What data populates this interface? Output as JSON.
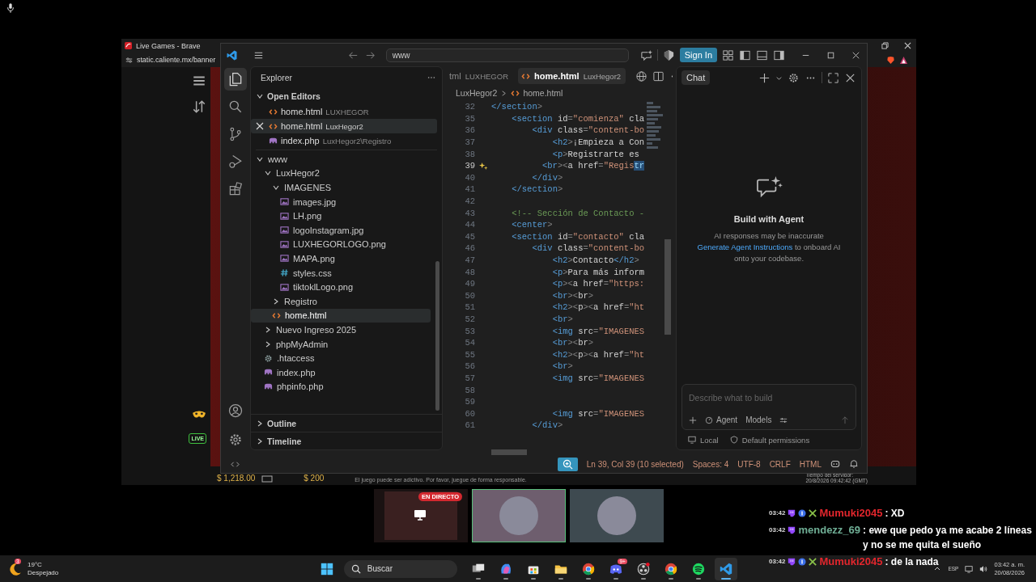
{
  "browser": {
    "tab_title": "Live Games - Brave",
    "address": "static.caliente.mx/banner",
    "live_badge": "LIVE",
    "balance": "$ 1,218.00",
    "bet": "$ 200",
    "disclaimer": "El juego puede ser adictivo. Por favor, juegue de forma responsable.",
    "server_time_label": "Tiempo del servidor:",
    "server_time": "20/8/2026 09:42:42 (GMT)"
  },
  "vscode": {
    "search": "www",
    "sign_in": "Sign In",
    "activity_bar": [
      {
        "kind": "files",
        "selected": true
      },
      {
        "kind": "search",
        "selected": false
      },
      {
        "kind": "source-control",
        "selected": false
      },
      {
        "kind": "run",
        "selected": false
      },
      {
        "kind": "extensions",
        "selected": false
      }
    ],
    "activity_bar_bottom": [
      {
        "kind": "account"
      },
      {
        "kind": "settings"
      }
    ],
    "explorer": {
      "title": "Explorer",
      "open_editors_title": "Open Editors",
      "open_editors": [
        {
          "name": "home.html",
          "description": "LUXHEGOR",
          "kind": "html",
          "selected": false
        },
        {
          "name": "home.html",
          "description": "LuxHegor2",
          "kind": "html",
          "selected": true
        },
        {
          "name": "index.php",
          "description": "LuxHegor2\\Registro",
          "kind": "php",
          "selected": false
        }
      ],
      "tree": [
        {
          "name": "www",
          "kind": "folder",
          "expanded": true,
          "selected": false,
          "children": [
            {
              "name": "LuxHegor2",
              "kind": "folder",
              "expanded": true,
              "selected": false,
              "children": [
                {
                  "name": "IMAGENES",
                  "kind": "folder",
                  "expanded": true,
                  "selected": false,
                  "children": [
                    {
                      "name": "images.jpg",
                      "kind": "image",
                      "selected": false
                    },
                    {
                      "name": "LH.png",
                      "kind": "image",
                      "selected": false
                    },
                    {
                      "name": "logoInstagram.jpg",
                      "kind": "image",
                      "selected": false
                    },
                    {
                      "name": "LUXHEGORLOGO.png",
                      "kind": "image",
                      "selected": false
                    },
                    {
                      "name": "MAPA.png",
                      "kind": "image",
                      "selected": false
                    },
                    {
                      "name": "styles.css",
                      "kind": "css",
                      "selected": false
                    },
                    {
                      "name": "tiktoklLogo.png",
                      "kind": "image",
                      "selected": false
                    }
                  ]
                },
                {
                  "name": "Registro",
                  "kind": "folder",
                  "expanded": false,
                  "selected": false
                },
                {
                  "name": "home.html",
                  "kind": "html",
                  "selected": true
                }
              ]
            },
            {
              "name": "Nuevo Ingreso 2025",
              "kind": "folder",
              "expanded": false,
              "selected": false
            },
            {
              "name": "phpMyAdmin",
              "kind": "folder",
              "expanded": false,
              "selected": false
            },
            {
              "name": ".htaccess",
              "kind": "config",
              "selected": false
            },
            {
              "name": "index.php",
              "kind": "php",
              "selected": false
            },
            {
              "name": "phpinfo.php",
              "kind": "php",
              "selected": false
            }
          ]
        }
      ],
      "sections": [
        {
          "title": "Outline",
          "expanded": false
        },
        {
          "title": "Timeline",
          "expanded": false
        }
      ]
    },
    "editor": {
      "tabs": [
        {
          "label": "tml",
          "description": "LUXHEGOR",
          "selected": false
        },
        {
          "label": "home.html",
          "description": "LuxHegor2",
          "selected": true
        }
      ],
      "breadcrumb": [
        "LuxHegor2",
        "home.html"
      ],
      "lines": [
        {
          "number": "32",
          "text": "</section>"
        },
        {
          "number": "35",
          "text": "    <section id=\"comienza\" cla"
        },
        {
          "number": "36",
          "text": "        <div class=\"content-bo"
        },
        {
          "number": "37",
          "text": "            <h2>¡Empieza a Con"
        },
        {
          "number": "38",
          "text": "            <p>Registrarte es"
        },
        {
          "number": "39",
          "text": "          <br><a href=\"Regis",
          "selected_text": "tr",
          "sparkle": true
        },
        {
          "number": "40",
          "text": "        </div>"
        },
        {
          "number": "41",
          "text": "    </section>"
        },
        {
          "number": "42"
        },
        {
          "number": "43",
          "text": "    <!-- Sección de Contacto -"
        },
        {
          "number": "44",
          "text": "    <center>"
        },
        {
          "number": "45",
          "text": "    <section id=\"contacto\" cla"
        },
        {
          "number": "46",
          "text": "        <div class=\"content-bo"
        },
        {
          "number": "47",
          "text": "            <h2>Contacto</h2>"
        },
        {
          "number": "48",
          "text": "            <p>Para más inform"
        },
        {
          "number": "49",
          "text": "            <p><a href=\"https:"
        },
        {
          "number": "50",
          "text": "            <br><br>"
        },
        {
          "number": "51",
          "text": "            <h2><p><a href=\"ht"
        },
        {
          "number": "52",
          "text": "            <br>"
        },
        {
          "number": "53",
          "text": "            <img src=\"IMAGENES"
        },
        {
          "number": "54",
          "text": "            <br><br>"
        },
        {
          "number": "55",
          "text": "            <h2><p><a href=\"ht"
        },
        {
          "number": "56",
          "text": "            <br>"
        },
        {
          "number": "57",
          "text": "            <img src=\"IMAGENES"
        },
        {
          "number": "58"
        },
        {
          "number": "59"
        },
        {
          "number": "60",
          "text": "            <img src=\"IMAGENES"
        },
        {
          "number": "61",
          "text": "        </div>"
        }
      ]
    },
    "chat": {
      "title": "Chat",
      "heading": "Build with Agent",
      "note": "AI responses may be inaccurate",
      "link": "Generate Agent Instructions",
      "link_rest": "to onboard AI onto your codebase.",
      "placeholder": "Describe what to build",
      "mode": "Agent",
      "models": "Models",
      "location": "Local",
      "permissions": "Default permissions"
    },
    "status_bar": {
      "items": [
        "Ln 39, Col 39 (10 selected)",
        "Spaces: 4",
        "UTF-8",
        "CRLF",
        "HTML"
      ]
    }
  },
  "thumbnails": [
    {
      "badge": "EN DIRECTO",
      "selected": false
    },
    {
      "selected": true
    },
    {
      "selected": false
    }
  ],
  "stream_chat": [
    {
      "time": "03:42",
      "kind": "full",
      "user": "Mumuki2045",
      "color": "#e3262d",
      "text": ": XD"
    },
    {
      "time": "03:42",
      "kind": "basic",
      "user": "mendezz_69",
      "color": "#6fae95",
      "text": ": ewe que pedo ya me acabe 2 líneas y no se me quita el sueño"
    },
    {
      "time": "03:42",
      "kind": "full",
      "user": "Mumuki2045",
      "color": "#e3262d",
      "text": ": de la nada"
    }
  ],
  "taskbar": {
    "weather": {
      "temperature": "19°C",
      "condition": "Despejado",
      "badge": "3"
    },
    "search": "Buscar",
    "apps": [
      {
        "kind": "task-view",
        "selected": false
      },
      {
        "kind": "copilot",
        "selected": false
      },
      {
        "kind": "store",
        "selected": false
      },
      {
        "kind": "files",
        "selected": false
      },
      {
        "kind": "chrome",
        "selected": false
      },
      {
        "kind": "discord",
        "selected": false,
        "badge": "9+"
      },
      {
        "kind": "obs",
        "selected": false
      },
      {
        "kind": "chrome",
        "selected": false
      },
      {
        "kind": "spotify",
        "selected": false
      },
      {
        "kind": "vscode",
        "selected": true
      }
    ],
    "language": "ESP",
    "time": "03:42 a. m.",
    "date": "20/08/2026"
  }
}
